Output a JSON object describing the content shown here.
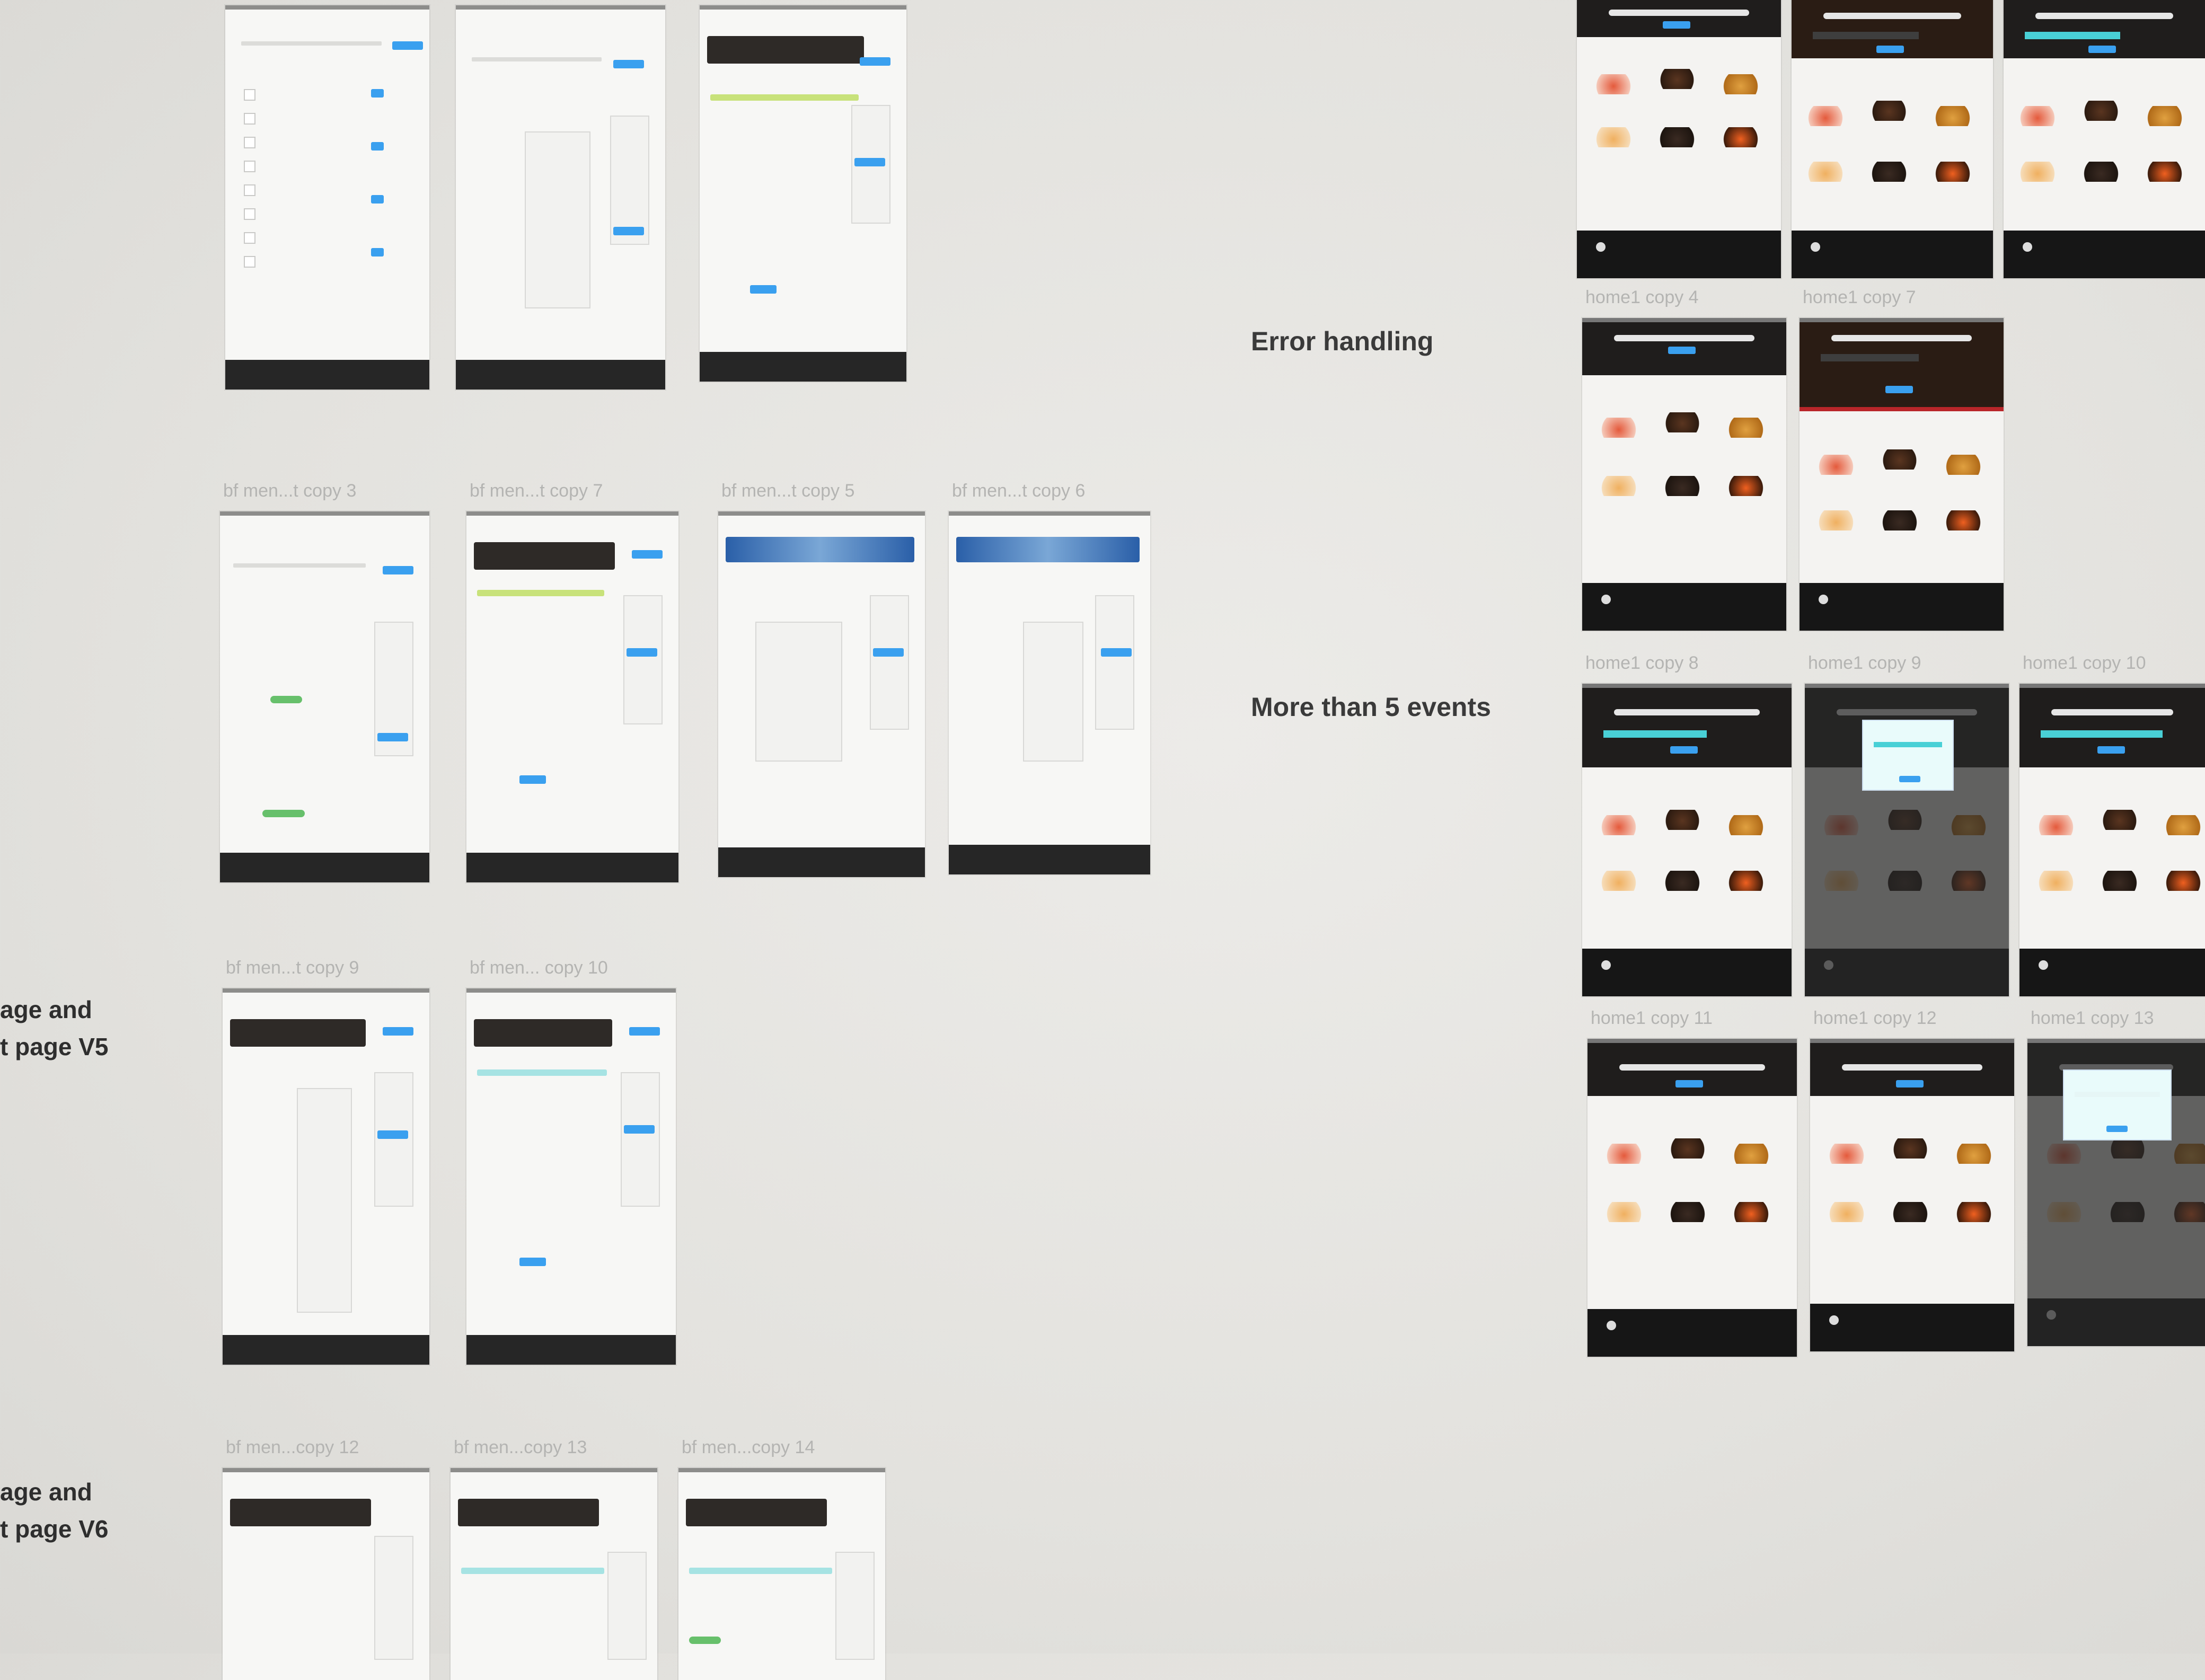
{
  "sections": {
    "error_handling": "Error handling",
    "more_than_5": "More than 5 events"
  },
  "left_labels": {
    "v5_line1": "age and",
    "v5_line2": "t page V5",
    "v6_line1": "age and",
    "v6_line2": "t page V6"
  },
  "artboard_labels": {
    "bf_copy3": "bf men...t copy 3",
    "bf_copy7": "bf men...t copy 7",
    "bf_copy5": "bf men...t copy 5",
    "bf_copy6": "bf men...t copy 6",
    "bf_copy9": "bf men...t copy 9",
    "bf_copy10": "bf men... copy 10",
    "bf_copy12": "bf men...copy 12",
    "bf_copy13": "bf men...copy 13",
    "bf_copy14": "bf men...copy 14",
    "home_copy4": "home1 copy 4",
    "home_copy7": "home1 copy 7",
    "home_copy8": "home1 copy 8",
    "home_copy9": "home1 copy 9",
    "home_copy10": "home1 copy 10",
    "home_copy11": "home1 copy 11",
    "home_copy12": "home1 copy 12",
    "home_copy13": "home1 copy 13"
  },
  "colors": {
    "accent_blue": "#3aa0ef",
    "footer_dark": "#262626",
    "error_red": "#b9262a",
    "cyan": "#49d0d6",
    "green": "#67c06b"
  }
}
